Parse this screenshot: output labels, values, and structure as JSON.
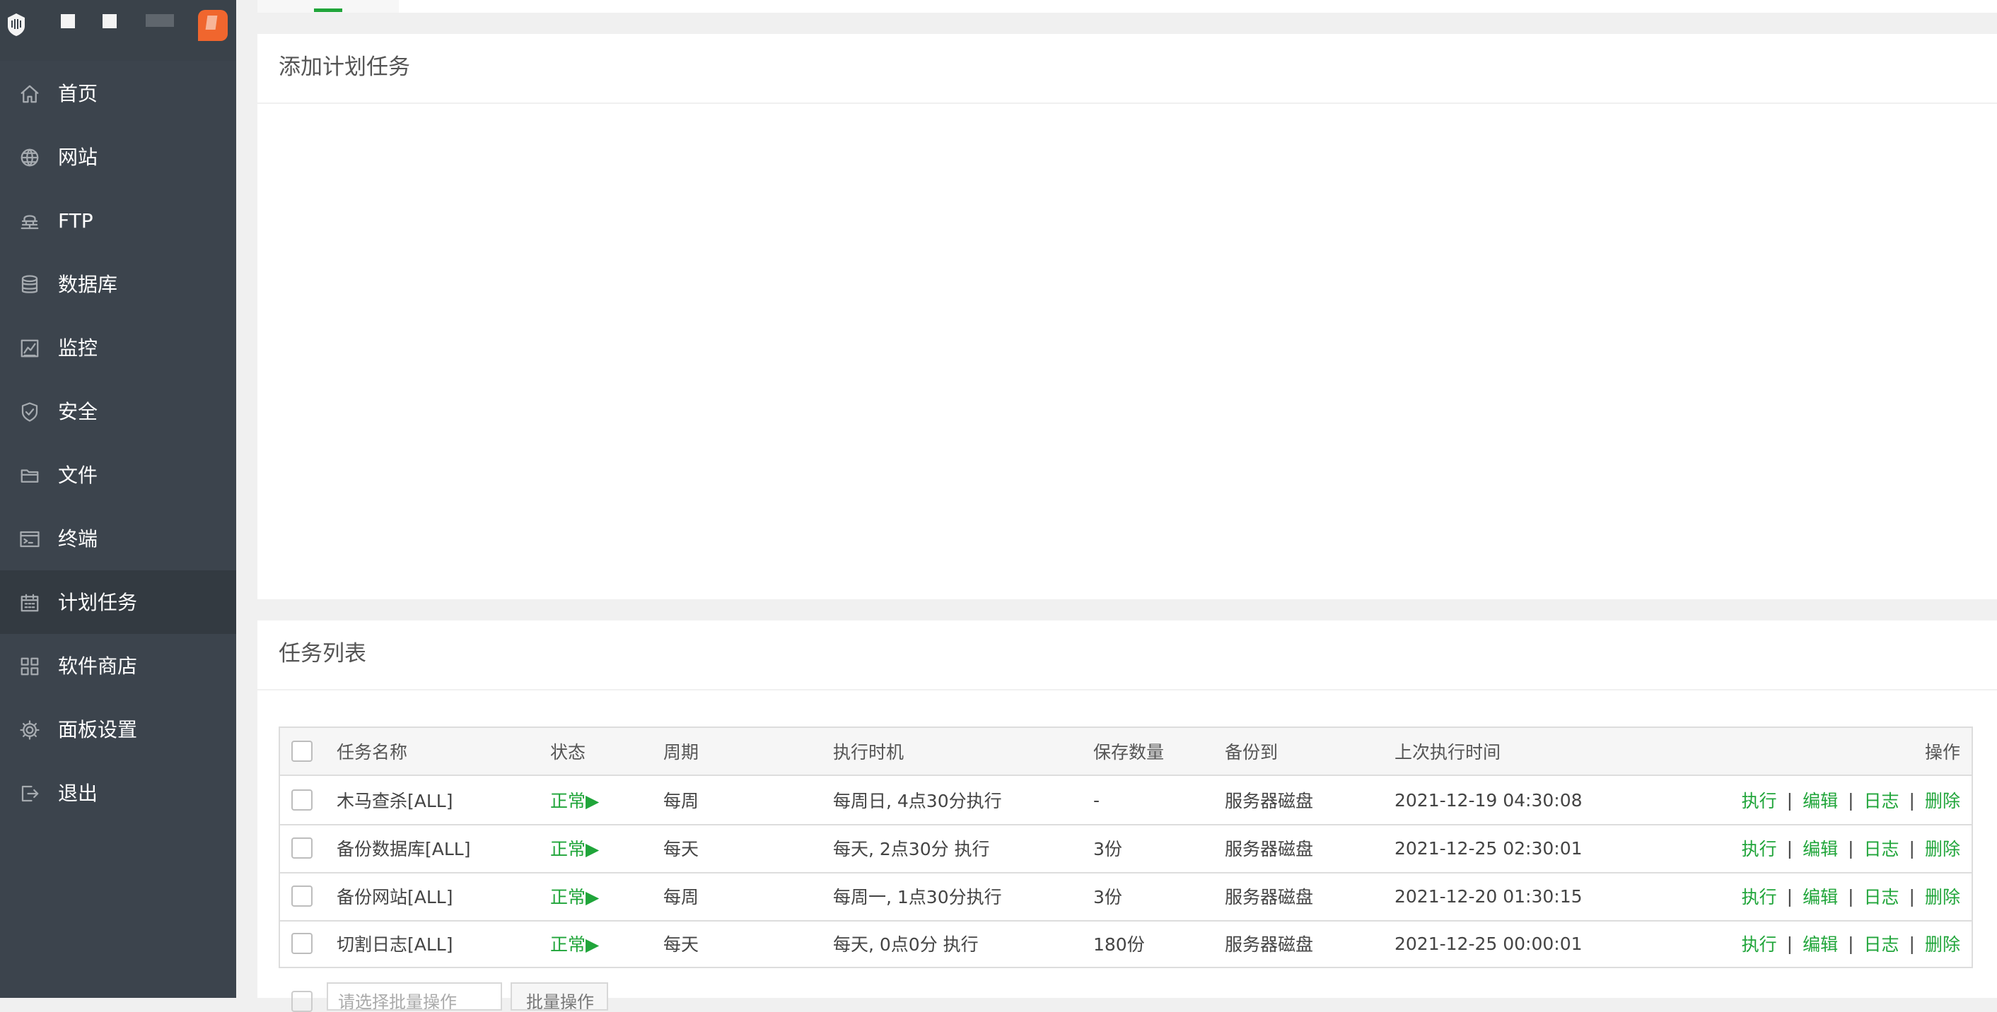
{
  "sidebar": {
    "items": [
      {
        "label": "首页",
        "icon": "home-icon"
      },
      {
        "label": "网站",
        "icon": "globe-icon"
      },
      {
        "label": "FTP",
        "icon": "ftp-icon"
      },
      {
        "label": "数据库",
        "icon": "database-icon"
      },
      {
        "label": "监控",
        "icon": "monitor-icon"
      },
      {
        "label": "安全",
        "icon": "shield-icon"
      },
      {
        "label": "文件",
        "icon": "folder-icon"
      },
      {
        "label": "终端",
        "icon": "terminal-icon"
      },
      {
        "label": "计划任务",
        "icon": "calendar-icon",
        "active": true
      },
      {
        "label": "软件商店",
        "icon": "grid-icon"
      },
      {
        "label": "面板设置",
        "icon": "gear-icon"
      },
      {
        "label": "退出",
        "icon": "logout-icon"
      }
    ]
  },
  "add_panel": {
    "title": "添加计划任务"
  },
  "list_panel": {
    "title": "任务列表",
    "columns": [
      "任务名称",
      "状态",
      "周期",
      "执行时机",
      "保存数量",
      "备份到",
      "上次执行时间",
      "操作"
    ],
    "rows": [
      {
        "name": "木马查杀[ALL]",
        "status": "正常▶",
        "cycle": "每周",
        "exec": "每周日, 4点30分执行",
        "keep": "-",
        "backup": "服务器磁盘",
        "last": "2021-12-19 04:30:08"
      },
      {
        "name": "备份数据库[ALL]",
        "status": "正常▶",
        "cycle": "每天",
        "exec": "每天, 2点30分 执行",
        "keep": "3份",
        "backup": "服务器磁盘",
        "last": "2021-12-25 02:30:01"
      },
      {
        "name": "备份网站[ALL]",
        "status": "正常▶",
        "cycle": "每周",
        "exec": "每周一, 1点30分执行",
        "keep": "3份",
        "backup": "服务器磁盘",
        "last": "2021-12-20 01:30:15"
      },
      {
        "name": "切割日志[ALL]",
        "status": "正常▶",
        "cycle": "每天",
        "exec": "每天, 0点0分 执行",
        "keep": "180份",
        "backup": "服务器磁盘",
        "last": "2021-12-25 00:00:01"
      }
    ],
    "actions": {
      "run": "执行",
      "edit": "编辑",
      "log": "日志",
      "delete": "删除",
      "separator": "|"
    },
    "batch": {
      "select_placeholder": "请选择批量操作",
      "button": "批量操作"
    }
  },
  "colors": {
    "sidebar_bg": "#3c444d",
    "active_bg": "#333a41",
    "accent": "#20a53a",
    "badge": "#f0662e"
  }
}
